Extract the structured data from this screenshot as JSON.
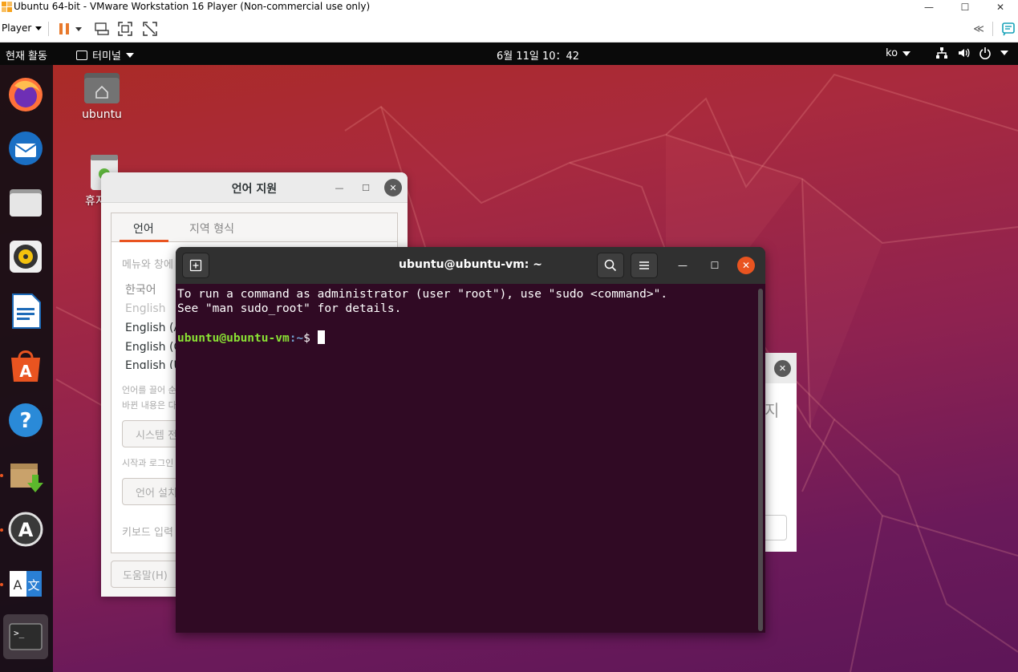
{
  "host_window": {
    "title": "Ubuntu 64-bit - VMware Workstation 16 Player (Non-commercial use only)",
    "minimize": "—",
    "maximize": "☐",
    "close": "✕",
    "menu_player": "Player",
    "collapse_label": "≪"
  },
  "topbar": {
    "activities": "현재 활동",
    "app_menu": "터미널",
    "clock": "6월 11일  10：42",
    "input_method": "ko"
  },
  "desktop": {
    "home_label": "ubuntu",
    "trash_label": "휴지"
  },
  "dock": {
    "items": [
      "firefox",
      "thunderbird",
      "files",
      "rhythmbox",
      "libreoffice-writer",
      "ubuntu-software",
      "help",
      "software-updater",
      "software-properties",
      "language-support",
      "terminal"
    ]
  },
  "lang_window": {
    "title": "언어 지원",
    "tabs": [
      "언어",
      "지역 형식"
    ],
    "menu_label": "메뉴와 창에",
    "languages": [
      "한국어",
      "English",
      "English (A",
      "English (C",
      "English (U"
    ],
    "drag_hint_1": "언어를 끌어 순",
    "drag_hint_2": "바뀐 내용은 다",
    "apply_button": "시스템 전",
    "login_hint": "시작과 로그인",
    "install_button": "언어 설치",
    "keyboard_label": "키보드 입력",
    "help_button": "도움말(H)"
  },
  "bg_dialog": {
    "partial_text": "지"
  },
  "terminal": {
    "title": "ubuntu@ubuntu-vm: ~",
    "line1": "To run a command as administrator (user \"root\"), use \"sudo <command>\".",
    "line2": "See \"man sudo_root\" for details.",
    "prompt_user": "ubuntu@ubuntu-vm",
    "prompt_path": ":~",
    "prompt_sym": "$ "
  },
  "colors": {
    "ubuntu_orange": "#e95420",
    "terminal_bg": "#300a24",
    "prompt_green": "#8ae234",
    "prompt_blue": "#729fcf"
  }
}
